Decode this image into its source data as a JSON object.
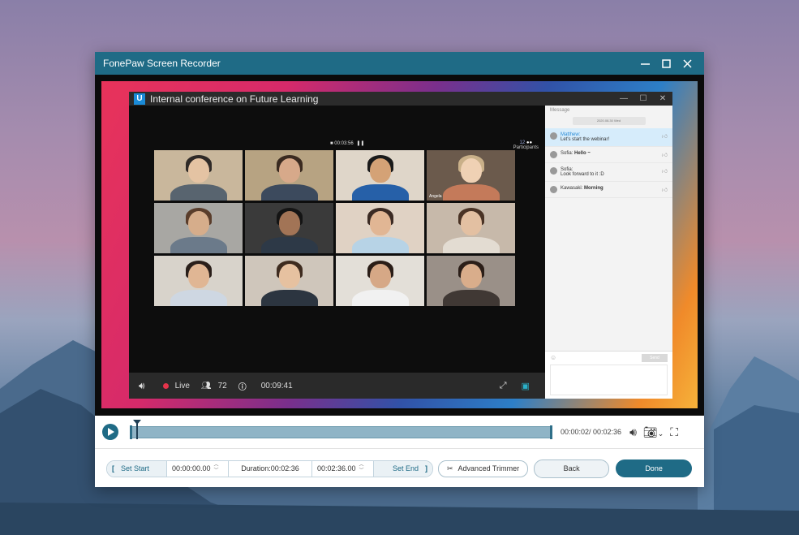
{
  "window": {
    "title": "FonePaw Screen Recorder",
    "controls": {
      "minimize": "—",
      "maximize": "☐",
      "close": "✕"
    }
  },
  "conference": {
    "logo": "U",
    "title": "Internal conference on Future Learning",
    "record_time": "00:03:56",
    "participants_count": "12",
    "participants_label": "Participants",
    "tile_names": [
      "",
      "",
      "",
      "Angela",
      "",
      "",
      "",
      "",
      "",
      "",
      "",
      ""
    ],
    "bottom_bar": {
      "live": "Live",
      "count": "72",
      "time": "00:09:41"
    }
  },
  "chat": {
    "header": "Message",
    "date": "2020.08.30 Wed",
    "messages": [
      {
        "name": "Matthew:",
        "text": "Let's start the webinar!",
        "highlight": true
      },
      {
        "name": "Sofia:",
        "text": "Hello ~",
        "highlight": false
      },
      {
        "name": "Sofia:",
        "text": "Look forward to it :D",
        "highlight": false
      },
      {
        "name": "Kawasaki:",
        "text": "Morning",
        "highlight": false
      }
    ],
    "send": "Send"
  },
  "player": {
    "time": "00:00:02/ 00:02:36"
  },
  "trim": {
    "set_start": "Set Start",
    "start_time": "00:00:00.00",
    "duration": "Duration:00:02:36",
    "end_time": "00:02:36.00",
    "set_end": "Set End",
    "advanced_trimmer": "Advanced Trimmer",
    "back": "Back",
    "done": "Done"
  },
  "colors": {
    "accent": "#1f6b86",
    "titlebar": "#1f6b86",
    "timeline_fill": "#8fb4c6"
  }
}
